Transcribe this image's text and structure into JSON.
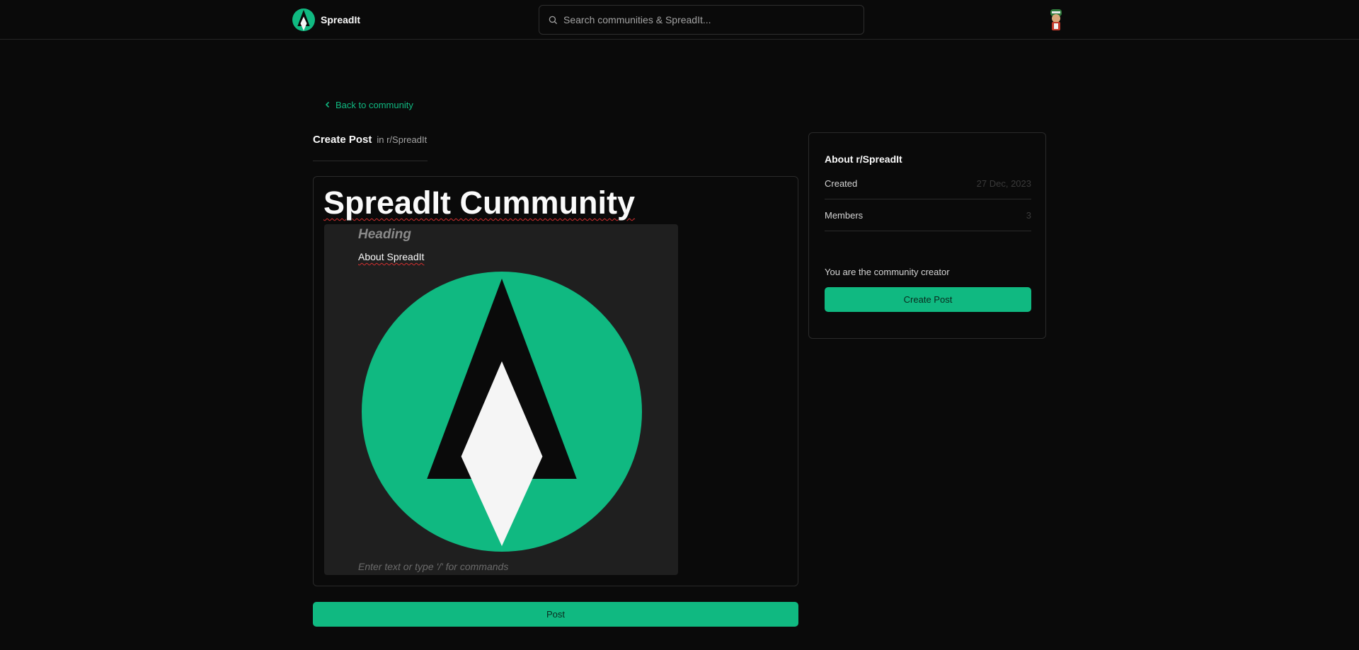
{
  "header": {
    "brand_name": "SpreadIt",
    "search_placeholder": "Search communities & SpreadIt...",
    "accent_color": "#10b981"
  },
  "back_link": {
    "label": "Back to community"
  },
  "create_post": {
    "title": "Create Post",
    "subtitle": "in r/SpreadIt"
  },
  "editor": {
    "post_title": "SpreadIt Cummunity",
    "heading_placeholder": "Heading",
    "about_text": "About SpreadIt",
    "body_placeholder": "Enter text or type '/' for commands"
  },
  "post_button": {
    "label": "Post"
  },
  "sidebar": {
    "heading": "About r/SpreadIt",
    "rows": [
      {
        "label": "Created",
        "value": "27 Dec, 2023"
      },
      {
        "label": "Members",
        "value": "3"
      }
    ],
    "creator_note": "You are the community creator",
    "create_post_label": "Create Post"
  }
}
